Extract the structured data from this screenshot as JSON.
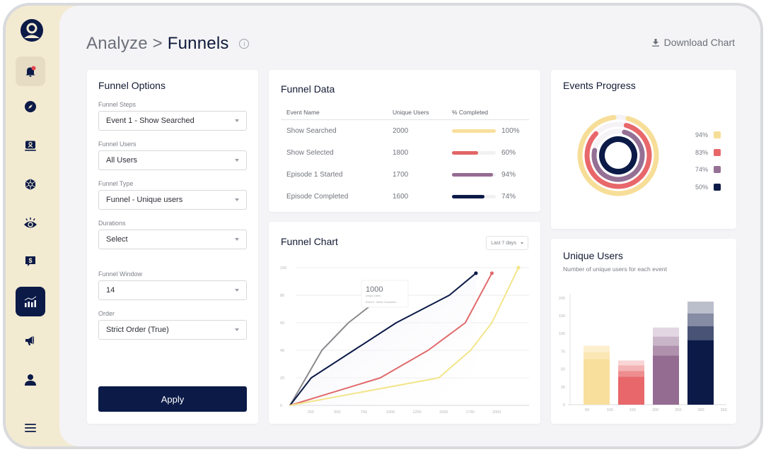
{
  "sidebar": {
    "items": [
      {
        "name": "notifications",
        "icon": "bell-icon",
        "state": "highlighted",
        "badge": true
      },
      {
        "name": "explore",
        "icon": "compass-icon"
      },
      {
        "name": "profile-card",
        "icon": "user-card-icon"
      },
      {
        "name": "network",
        "icon": "network-icon"
      },
      {
        "name": "insights",
        "icon": "eye-icon"
      },
      {
        "name": "revenue",
        "icon": "dollar-chat-icon"
      },
      {
        "name": "analyze",
        "icon": "bar-chart-icon",
        "state": "active"
      },
      {
        "name": "campaigns",
        "icon": "megaphone-icon"
      },
      {
        "name": "users",
        "icon": "person-icon"
      },
      {
        "name": "menu",
        "icon": "hamburger-icon"
      }
    ]
  },
  "header": {
    "breadcrumb_parent": "Analyze",
    "separator": ">",
    "breadcrumb_current": "Funnels",
    "info_glyph": "i",
    "download_label": "Download Chart"
  },
  "funnel_options": {
    "title": "Funnel Options",
    "fields": [
      {
        "label": "Funnel Steps",
        "value": "Event 1 - Show Searched"
      },
      {
        "label": "Funnel Users",
        "value": "All Users"
      },
      {
        "label": "Funnel Type",
        "value": "Funnel - Unique users"
      },
      {
        "label": "Durations",
        "value": "Select"
      },
      {
        "label": "Funnel Window",
        "value": "14"
      },
      {
        "label": "Order",
        "value": "Strict Order (True)"
      }
    ],
    "apply_label": "Apply"
  },
  "funnel_data": {
    "title": "Funnel Data",
    "columns": [
      "Event Name",
      "Unique Users",
      "% Completed"
    ],
    "rows": [
      {
        "event": "Show Searched",
        "users": "2000",
        "pct_label": "100%",
        "pct": 100,
        "color": "#f9df9c"
      },
      {
        "event": "Show Selected",
        "users": "1800",
        "pct_label": "60%",
        "pct": 60,
        "color": "#e26566"
      },
      {
        "event": "Episode 1 Started",
        "users": "1700",
        "pct_label": "94%",
        "pct": 94,
        "color": "#946c92"
      },
      {
        "event": "Episode Completed",
        "users": "1600",
        "pct_label": "74%",
        "pct": 74,
        "color": "#0b1a47"
      }
    ]
  },
  "events_progress": {
    "title": "Events Progress",
    "items": [
      {
        "label": "94%",
        "value": 94,
        "color": "#f7de98"
      },
      {
        "label": "83%",
        "value": 83,
        "color": "#e8676a"
      },
      {
        "label": "74%",
        "value": 74,
        "color": "#957095"
      },
      {
        "label": "50%",
        "value": 50,
        "color": "#0b1a47"
      }
    ]
  },
  "funnel_chart": {
    "title": "Funnel Chart",
    "range_label": "Last 7 days",
    "tooltip": {
      "value": "1000",
      "label": "Unique Users",
      "event": "Event 5 - Series Completed"
    }
  },
  "unique_users": {
    "title": "Unique Users",
    "subtitle": "Number of unique users for each event"
  },
  "chart_data": [
    {
      "type": "line",
      "title": "Funnel Chart",
      "xlabel": "",
      "ylabel": "",
      "x_ticks": [
        "250",
        "500",
        "750",
        "1000",
        "1250",
        "1500",
        "1750",
        "2000"
      ],
      "y_ticks": [
        "0",
        "20",
        "40",
        "60",
        "80",
        "100"
      ],
      "xlim": [
        0,
        2250
      ],
      "ylim": [
        0,
        100
      ],
      "grid": true,
      "series": [
        {
          "name": "grey",
          "color": "#8c8a8e",
          "points": [
            [
              0,
              0
            ],
            [
              150,
              20
            ],
            [
              300,
              40
            ],
            [
              550,
              60
            ],
            [
              800,
              75
            ]
          ]
        },
        {
          "name": "navy",
          "color": "#0b1a47",
          "points": [
            [
              0,
              0
            ],
            [
              200,
              20
            ],
            [
              600,
              40
            ],
            [
              1000,
              60
            ],
            [
              1500,
              80
            ],
            [
              1750,
              96
            ]
          ],
          "end_marker": true
        },
        {
          "name": "red",
          "color": "#e06a6c",
          "points": [
            [
              0,
              0
            ],
            [
              850,
              20
            ],
            [
              1300,
              40
            ],
            [
              1650,
              60
            ],
            [
              1900,
              96
            ]
          ],
          "end_marker": true
        },
        {
          "name": "yellow",
          "color": "#f3e58a",
          "points": [
            [
              0,
              0
            ],
            [
              1400,
              20
            ],
            [
              1700,
              40
            ],
            [
              1900,
              60
            ],
            [
              2150,
              100
            ]
          ],
          "end_marker": true
        }
      ]
    },
    {
      "type": "bar",
      "title": "Unique Users",
      "subtitle": "Number of unique users for each event",
      "x_ticks": [
        "50",
        "100",
        "150",
        "200",
        "250",
        "300",
        "350"
      ],
      "y_ticks": [
        "0",
        "25",
        "50",
        "75",
        "100",
        "150",
        "200"
      ],
      "stacked": true,
      "ylim": [
        0,
        150
      ],
      "series": [
        {
          "name": "Show Searched",
          "color": "#f9df9c",
          "segments": [
            65,
            10,
            9
          ]
        },
        {
          "name": "Show Selected",
          "color": "#e8676a",
          "segments": [
            40,
            8,
            8,
            7
          ]
        },
        {
          "name": "Episode 1 Started",
          "color": "#946c92",
          "segments": [
            70,
            14,
            13,
            13
          ]
        },
        {
          "name": "Episode Completed",
          "color": "#0b1a47",
          "segments": [
            92,
            20,
            18,
            17
          ]
        }
      ]
    },
    {
      "type": "pie",
      "title": "Events Progress",
      "style": "radial-rings",
      "values": [
        94,
        83,
        74,
        50
      ],
      "labels": [
        "94%",
        "83%",
        "74%",
        "50%"
      ]
    }
  ]
}
